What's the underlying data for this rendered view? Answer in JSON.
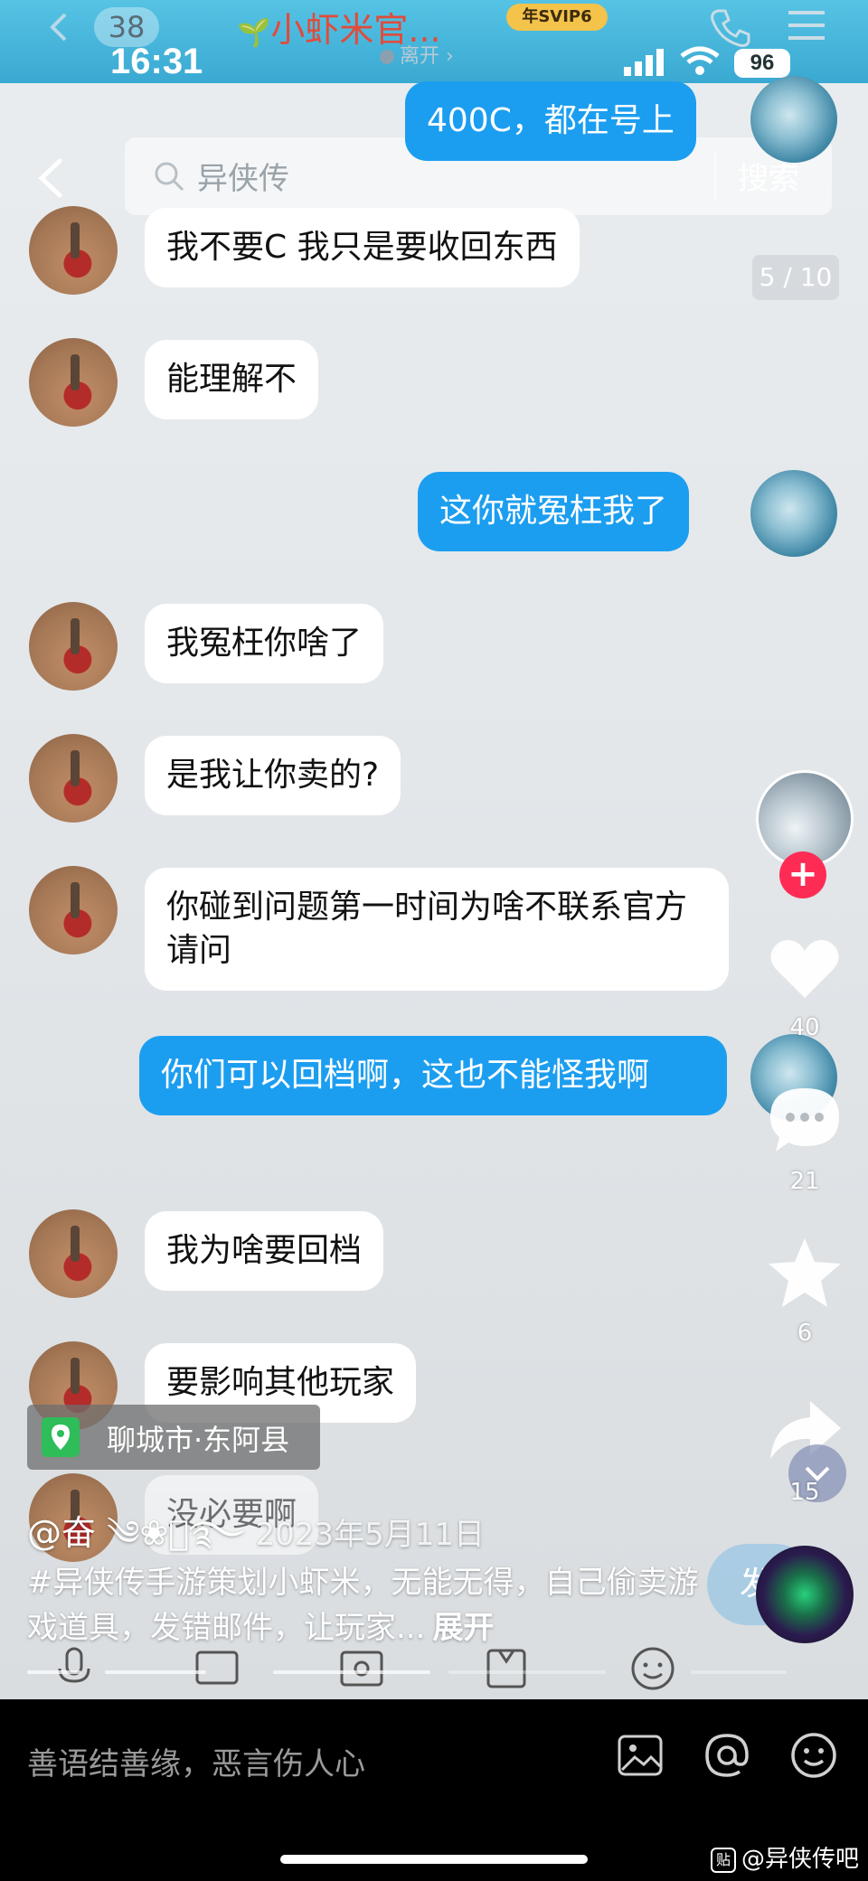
{
  "qq_header": {
    "unread_count": "38",
    "chat_title": "小虾米官...",
    "svip_label": "年SVIP6",
    "status": "离开",
    "time": "16:31",
    "battery": "96"
  },
  "search": {
    "query": "异侠传",
    "button": "搜索"
  },
  "page_indicator": "5 / 10",
  "messages": [
    {
      "side": "right",
      "text": "400C，都在号上"
    },
    {
      "side": "left",
      "text": "我不要C 我只是要收回东西"
    },
    {
      "side": "left",
      "text": "能理解不"
    },
    {
      "side": "right",
      "text": "这你就冤枉我了"
    },
    {
      "side": "left",
      "text": "我冤枉你啥了"
    },
    {
      "side": "left",
      "text": "是我让你卖的?"
    },
    {
      "side": "left",
      "text": "你碰到问题第一时间为啥不联系官方请问"
    },
    {
      "side": "right",
      "text": "你们可以回档啊，这也不能怪我啊"
    },
    {
      "side": "left",
      "text": "我为啥要回档"
    },
    {
      "side": "left",
      "text": "要影响其他玩家"
    },
    {
      "side": "left",
      "text": "没必要啊"
    }
  ],
  "actions": {
    "likes": "40",
    "comments": "21",
    "favorites": "6",
    "shares": "15"
  },
  "location": "聊城市·东阿县",
  "post": {
    "author": "@奋 ༄❀ཻ࿐",
    "date": "2023年5月11日",
    "caption": "#异侠传手游策划小虾米，无能无得，自己偷卖游戏道具，发错邮件，让玩家...",
    "expand": "展开",
    "send_partial": "发"
  },
  "comment_bar": {
    "placeholder": "善语结善缘，恶言伤人心"
  },
  "watermark": {
    "badge": "贴",
    "text": "@异侠传吧"
  },
  "icons": [
    "back-icon",
    "phone-icon",
    "menu-icon",
    "search-icon",
    "heart-icon",
    "comment-icon",
    "star-icon",
    "share-icon",
    "location-pin-icon",
    "image-icon",
    "at-icon",
    "emoji-icon"
  ]
}
